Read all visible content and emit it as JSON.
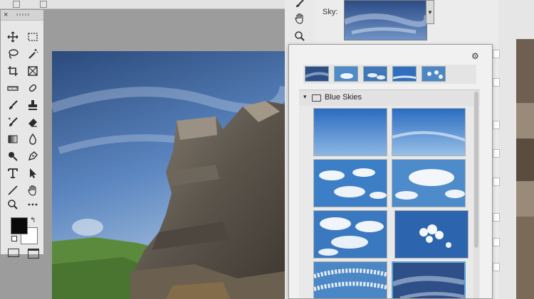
{
  "dialog": {
    "sky_label": "Sky:"
  },
  "sky_picker": {
    "folder_name": "Blue Skies"
  },
  "tools_panel": {
    "close_glyph": "×"
  },
  "colors": {
    "foreground": "#0a0a0a",
    "background": "#ffffff",
    "selection_accent": "#5aa6d8"
  }
}
